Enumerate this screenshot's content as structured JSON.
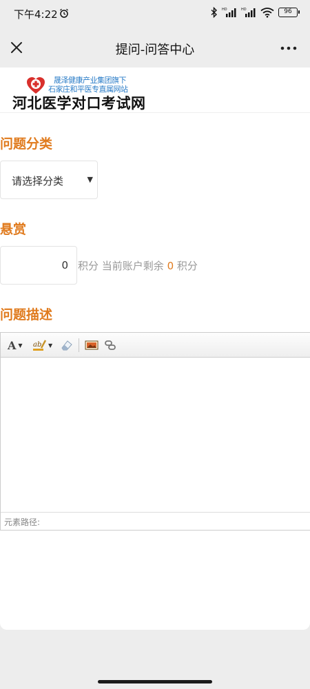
{
  "status": {
    "time": "下午4:22",
    "battery": "96"
  },
  "nav": {
    "title": "提问-问答中心"
  },
  "logo": {
    "sub_line1": "晟泽健康产业集团旗下",
    "sub_line2": "石家庄和平医专直属网站",
    "main": "河北医学对口考试网"
  },
  "form": {
    "category_heading": "问题分类",
    "category_placeholder": "请选择分类",
    "reward_heading": "悬赏",
    "reward_value": "0",
    "reward_unit": "积分",
    "balance_prefix": "当前账户剩余",
    "balance_value": "0",
    "balance_unit": "积分",
    "desc_heading": "问题描述"
  },
  "editor": {
    "font_glyph": "A",
    "element_path_label": "元素路径:"
  },
  "icons": [
    "alarm-icon",
    "bluetooth-icon",
    "signal-icon",
    "wifi-icon",
    "battery-icon",
    "close-icon",
    "more-icon",
    "hospital-cross-icon",
    "font-icon",
    "font-color-icon",
    "eraser-icon",
    "image-icon",
    "link-icon"
  ],
  "colors": {
    "accent": "#e07b1e",
    "logo_blue": "#2a7cc7",
    "background": "#ededed"
  }
}
